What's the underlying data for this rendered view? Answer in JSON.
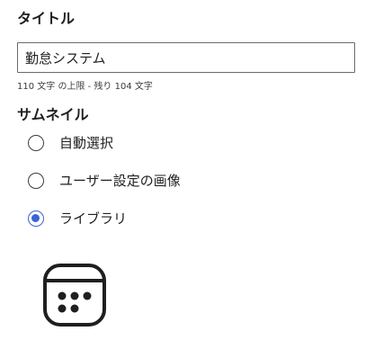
{
  "title_section": {
    "heading": "タイトル",
    "input_value": "勤怠システム",
    "hint": "110 文字 の上限 - 残り 104 文字"
  },
  "thumbnail_section": {
    "heading": "サムネイル",
    "options": [
      {
        "label": "自動選択",
        "selected": false
      },
      {
        "label": "ユーザー設定の画像",
        "selected": false
      },
      {
        "label": "ライブラリ",
        "selected": true
      }
    ],
    "library_icon": "calendar-icon"
  },
  "colors": {
    "accent": "#3a63d6",
    "text": "#1f1f1f",
    "border": "#6b6b6b"
  }
}
